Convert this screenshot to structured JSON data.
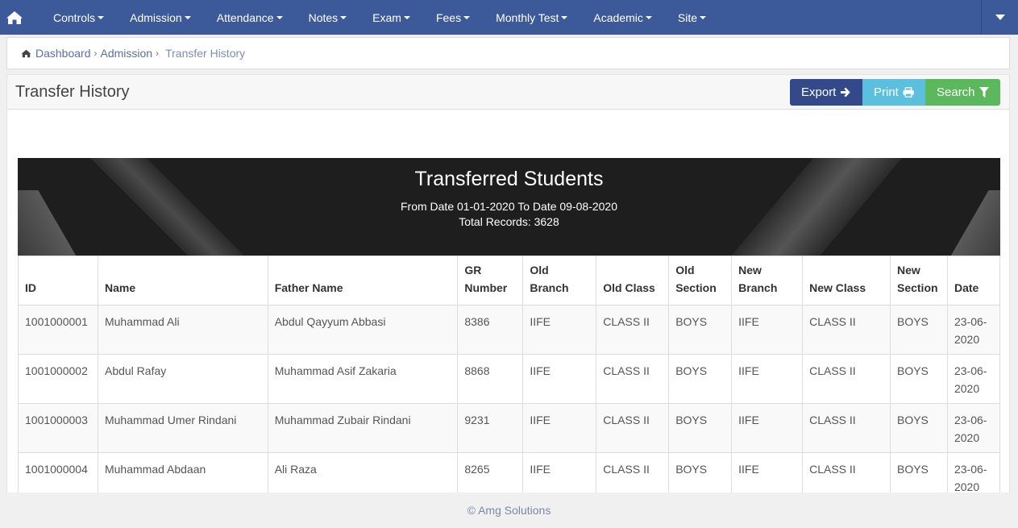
{
  "nav": {
    "items": [
      {
        "label": "Controls"
      },
      {
        "label": "Admission"
      },
      {
        "label": "Attendance"
      },
      {
        "label": "Notes"
      },
      {
        "label": "Exam"
      },
      {
        "label": "Fees"
      },
      {
        "label": "Monthly Test"
      },
      {
        "label": "Academic"
      },
      {
        "label": "Site"
      }
    ]
  },
  "breadcrumb": {
    "dashboard": "Dashboard",
    "admission": "Admission",
    "current": "Transfer History"
  },
  "panel": {
    "title": "Transfer History",
    "export_label": "Export",
    "print_label": "Print",
    "search_label": "Search"
  },
  "report": {
    "title": "Transferred Students",
    "date_range": "From Date 01-01-2020 To Date 09-08-2020",
    "total": "Total Records: 3628"
  },
  "table": {
    "headers": [
      "ID",
      "Name",
      "Father Name",
      "GR Number",
      "Old Branch",
      "Old Class",
      "Old Section",
      "New Branch",
      "New Class",
      "New Section",
      "Date"
    ],
    "rows": [
      [
        "1001000001",
        "Muhammad Ali",
        "Abdul Qayyum Abbasi",
        "8386",
        "IIFE",
        "CLASS II",
        "BOYS",
        "IIFE",
        "CLASS II",
        "BOYS",
        "23-06-2020"
      ],
      [
        "1001000002",
        "Abdul Rafay",
        "Muhammad Asif Zakaria",
        "8868",
        "IIFE",
        "CLASS II",
        "BOYS",
        "IIFE",
        "CLASS II",
        "BOYS",
        "23-06-2020"
      ],
      [
        "1001000003",
        "Muhammad Umer Rindani",
        "Muhammad Zubair Rindani",
        "9231",
        "IIFE",
        "CLASS II",
        "BOYS",
        "IIFE",
        "CLASS II",
        "BOYS",
        "23-06-2020"
      ],
      [
        "1001000004",
        "Muhammad Abdaan",
        "Ali Raza",
        "8265",
        "IIFE",
        "CLASS II",
        "BOYS",
        "IIFE",
        "CLASS II",
        "BOYS",
        "23-06-2020"
      ]
    ]
  },
  "footer": {
    "text": "© Amg Solutions"
  },
  "colors": {
    "nav_bg": "#3c5a99",
    "export": "#34498a",
    "print": "#5bc0de",
    "search": "#5cb85c"
  },
  "icons": {
    "home": "home-icon",
    "export": "arrow-right-icon",
    "print": "printer-icon",
    "search": "filter-icon"
  }
}
